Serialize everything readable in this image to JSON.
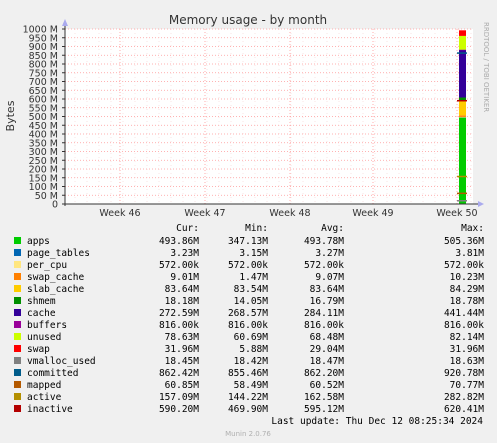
{
  "chart_data": {
    "type": "area",
    "title": "Memory usage - by month",
    "ylabel": "Bytes",
    "watermark": "RRDTOOL / TOBI OETIKER",
    "ylim": [
      0,
      1000
    ],
    "y_unit": "M",
    "y_ticks": [
      0,
      50,
      100,
      150,
      200,
      250,
      300,
      350,
      400,
      450,
      500,
      550,
      600,
      650,
      700,
      750,
      800,
      850,
      900,
      950,
      1000
    ],
    "y_tick_labels": [
      "0",
      "50 M",
      "100 M",
      "150 M",
      "200 M",
      "250 M",
      "300 M",
      "350 M",
      "400 M",
      "450 M",
      "500 M",
      "550 M",
      "600 M",
      "650 M",
      "700 M",
      "750 M",
      "800 M",
      "850 M",
      "900 M",
      "950 M",
      "1000 M"
    ],
    "x_tick_labels": [
      "Week 46",
      "Week 47",
      "Week 48",
      "Week 49",
      "Week 50"
    ],
    "grid": true,
    "legend_columns": [
      "Cur:",
      "Min:",
      "Avg:",
      "Max:"
    ],
    "series": [
      {
        "name": "apps",
        "color": "#00cc00",
        "cur": "493.86M",
        "min": "347.13M",
        "avg": "493.78M",
        "max": "505.36M",
        "value": 493.86
      },
      {
        "name": "page_tables",
        "color": "#0066b3",
        "cur": "3.23M",
        "min": "3.15M",
        "avg": "3.27M",
        "max": "3.81M",
        "value": 3.23
      },
      {
        "name": "per_cpu",
        "color": "#ffe680",
        "cur": "572.00k",
        "min": "572.00k",
        "avg": "572.00k",
        "max": "572.00k",
        "value": 0.572
      },
      {
        "name": "swap_cache",
        "color": "#ff8000",
        "cur": "9.01M",
        "min": "1.47M",
        "avg": "9.07M",
        "max": "10.23M",
        "value": 9.01
      },
      {
        "name": "slab_cache",
        "color": "#ffcc00",
        "cur": "83.64M",
        "min": "83.54M",
        "avg": "83.64M",
        "max": "84.29M",
        "value": 83.64
      },
      {
        "name": "shmem",
        "color": "#008f00",
        "cur": "18.18M",
        "min": "14.05M",
        "avg": "16.79M",
        "max": "18.78M",
        "value": 18.18
      },
      {
        "name": "cache",
        "color": "#330099",
        "cur": "272.59M",
        "min": "268.57M",
        "avg": "284.11M",
        "max": "441.44M",
        "value": 272.59
      },
      {
        "name": "buffers",
        "color": "#990099",
        "cur": "816.00k",
        "min": "816.00k",
        "avg": "816.00k",
        "max": "816.00k",
        "value": 0.816
      },
      {
        "name": "unused",
        "color": "#ccff00",
        "cur": "78.63M",
        "min": "60.69M",
        "avg": "68.48M",
        "max": "82.14M",
        "value": 78.63
      },
      {
        "name": "swap",
        "color": "#ff0000",
        "cur": "31.96M",
        "min": "5.88M",
        "avg": "29.04M",
        "max": "31.96M",
        "value": 31.96
      },
      {
        "name": "vmalloc_used",
        "color": "#808080",
        "cur": "18.45M",
        "min": "18.42M",
        "avg": "18.47M",
        "max": "18.63M",
        "line": 18.45
      },
      {
        "name": "committed",
        "color": "#005c8a",
        "cur": "862.42M",
        "min": "855.46M",
        "avg": "862.20M",
        "max": "920.78M",
        "line": 862.42
      },
      {
        "name": "mapped",
        "color": "#b35900",
        "cur": "60.85M",
        "min": "58.49M",
        "avg": "60.52M",
        "max": "70.77M",
        "line": 60.85
      },
      {
        "name": "active",
        "color": "#b38f00",
        "cur": "157.09M",
        "min": "144.22M",
        "avg": "162.58M",
        "max": "282.82M",
        "line": 157.09
      },
      {
        "name": "inactive",
        "color": "#b30000",
        "cur": "590.20M",
        "min": "469.90M",
        "avg": "595.12M",
        "max": "620.41M",
        "line": 590.2
      }
    ],
    "last_update": "Last update: Thu Dec 12 08:25:34 2024",
    "footer": "Munin 2.0.76"
  }
}
